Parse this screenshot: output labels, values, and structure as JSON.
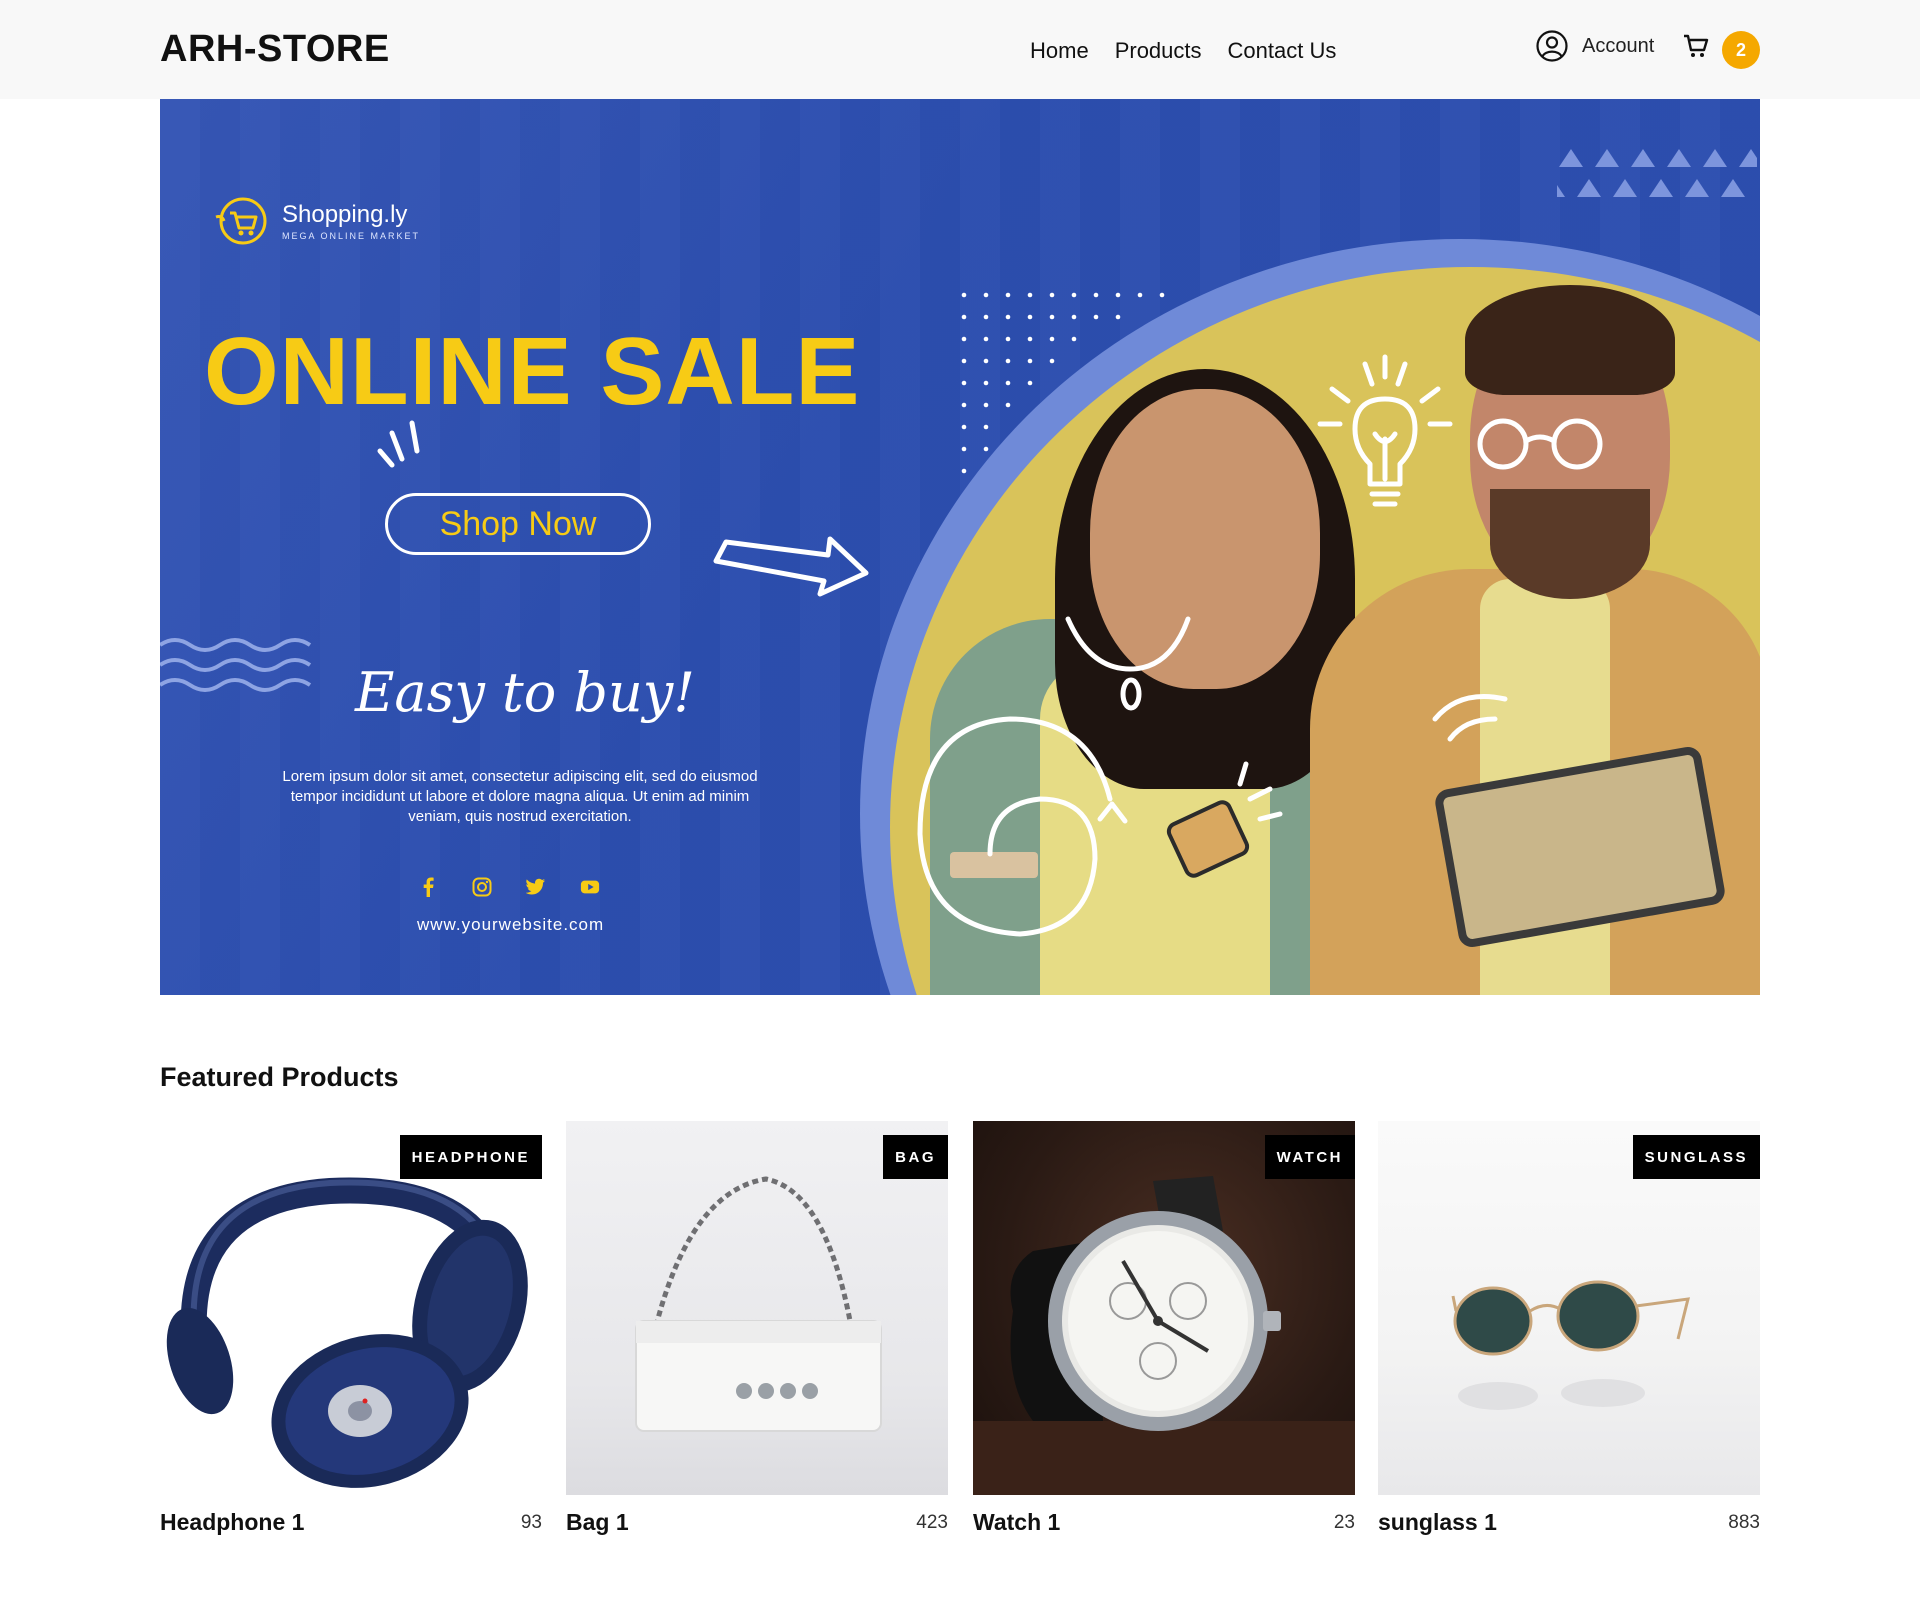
{
  "header": {
    "logo": "ARH-STORE",
    "nav": [
      "Home",
      "Products",
      "Contact Us"
    ],
    "account_label": "Account",
    "cart_count": "2"
  },
  "banner": {
    "brand_name": "Shopping.ly",
    "brand_tagline": "MEGA ONLINE MARKET",
    "headline": "ONLINE SALE",
    "cta_label": "Shop Now",
    "script_text": "Easy to buy!",
    "body_text": "Lorem ipsum dolor sit amet, consectetur adipiscing elit, sed do eiusmod tempor incididunt ut labore et dolore magna aliqua. Ut enim ad minim veniam, quis nostrud exercitation.",
    "website": "www.yourwebsite.com",
    "social_icons": [
      "facebook-icon",
      "instagram-icon",
      "twitter-icon",
      "youtube-icon"
    ],
    "colors": {
      "background": "#2d4fb0",
      "accent": "#f7cb15",
      "circle": "#d9c35a"
    }
  },
  "featured": {
    "title": "Featured Products",
    "products": [
      {
        "tag": "HEADPHONE",
        "name": "Headphone 1",
        "price": "93"
      },
      {
        "tag": "BAG",
        "name": "Bag 1",
        "price": "423"
      },
      {
        "tag": "WATCH",
        "name": "Watch 1",
        "price": "23"
      },
      {
        "tag": "SUNGLASS",
        "name": "sunglass 1",
        "price": "883"
      }
    ]
  },
  "colors": {
    "badge": "#f5a800",
    "header_bg": "#f8f8f8"
  }
}
